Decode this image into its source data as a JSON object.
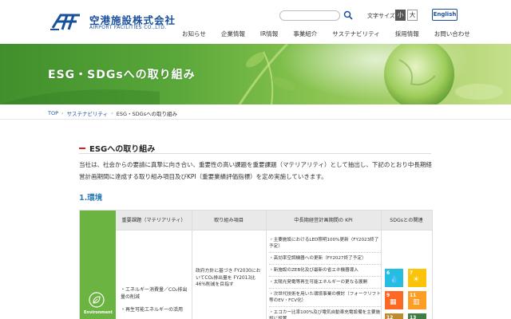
{
  "header": {
    "company_ja": "空港施設株式会社",
    "company_en": "AIRPORT FACILITIES CO.,LTD.",
    "search_placeholder": "",
    "font_size_label": "文字サイズ",
    "font_small": "小",
    "font_large": "大",
    "english_label": "English",
    "nav": [
      "お知らせ",
      "企業情報",
      "IR情報",
      "事業紹介",
      "サステナビリティ",
      "採用情報",
      "お問い合わせ"
    ]
  },
  "hero": {
    "title": "ESG・SDGsへの取り組み"
  },
  "breadcrumb": [
    "TOP",
    "サステナビリティ",
    "ESG・SDGsへの取り組み"
  ],
  "section": {
    "title": "ESGへの取り組み",
    "intro": "当社は、社会からの要請に真摯に向き合い、重要性の高い課題を重要課題（マテリアリティ）として抽出し、下記のとおり中長期経営計画期間に達成する取り組み項目及びKPI（重要業績評価指標）を定め実施していきます。",
    "sub_title": "1.環境"
  },
  "table": {
    "headers": [
      "重要課題（マテリアリティ）",
      "取り組み項目",
      "中長期経営計画期間の KPI",
      "SDGsとの関連"
    ],
    "category_label": "Environment",
    "materiality": [
      "・エネルギー消費量／CO₂排出量の削減",
      "・再生可能エネルギーの活用"
    ],
    "initiative": "政府方針に基づき FY2030においてCO₂排出量を FY2013比46%削減を目指す",
    "kpi": [
      "・主要施設におけるLED照明100%更新（FY2023終了予定）",
      "・高効率空調機器への更新（FY2027終了予定）",
      "・新施設のZEB化及び最新の省エネ機器導入",
      "・太陽光発電等再生可能エネルギーの更なる展開",
      "・次世代技術を用いた環境事業の検討（フォークリフト等のEV・FCV化）",
      "・エコカー比率100%及び電気自動車充電設備を主要施設に設置"
    ],
    "sdgs": [
      {
        "num": "6",
        "color": "#26bde2",
        "glyph": "💧"
      },
      {
        "num": "7",
        "color": "#fcc30b",
        "glyph": "☀"
      },
      {
        "num": "9",
        "color": "#fd6925",
        "glyph": "▦"
      },
      {
        "num": "11",
        "color": "#fd9d24",
        "glyph": "▥"
      },
      {
        "num": "12",
        "color": "#bf8b2e",
        "glyph": "∞"
      },
      {
        "num": "13",
        "color": "#3f7e44",
        "glyph": "◉"
      }
    ]
  },
  "colors": {
    "brand_blue": "#1a4f9c",
    "accent_red": "#d9241a",
    "env_green": "#6cb441",
    "subhead_blue": "#2e7fb8"
  }
}
